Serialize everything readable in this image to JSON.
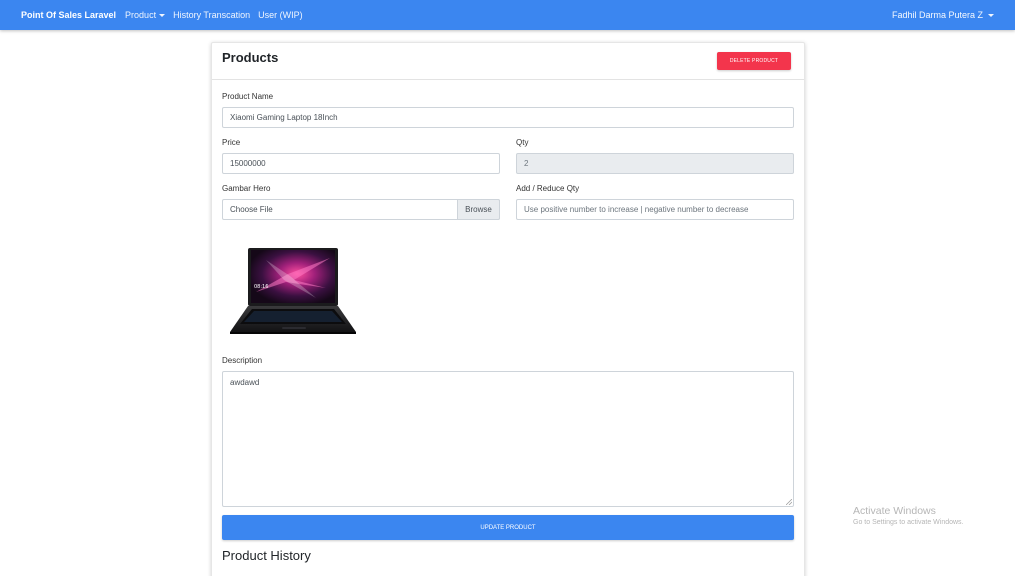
{
  "navbar": {
    "brand": "Point Of Sales Laravel",
    "links": [
      {
        "label": "Product",
        "dropdown": true
      },
      {
        "label": "History Transcation",
        "dropdown": false
      },
      {
        "label": "User (WIP)",
        "dropdown": false
      }
    ],
    "user": "Fadhil Darma Putera Z",
    "color": "#3b86f0"
  },
  "card": {
    "title": "Products",
    "delete_label": "DELETE PRODUCT",
    "delete_color": "#f3354c"
  },
  "form": {
    "product_name": {
      "label": "Product Name",
      "value": "Xiaomi Gaming Laptop 18Inch"
    },
    "price": {
      "label": "Price",
      "value": "15000000"
    },
    "qty": {
      "label": "Qty",
      "value": "2"
    },
    "hero": {
      "label": "Gambar Hero",
      "value": "Choose File",
      "browse": "Browse"
    },
    "add_reduce": {
      "label": "Add / Reduce Qty",
      "placeholder": "Use positive number to increase | negative number to decrease"
    },
    "description": {
      "label": "Description",
      "value": "awdawd"
    },
    "hero_image_time": "08:16"
  },
  "update_label": "UPDATE PRODUCT",
  "history_title": "Product History",
  "watermark": {
    "title": "Activate Windows",
    "subtitle": "Go to Settings to activate Windows."
  }
}
